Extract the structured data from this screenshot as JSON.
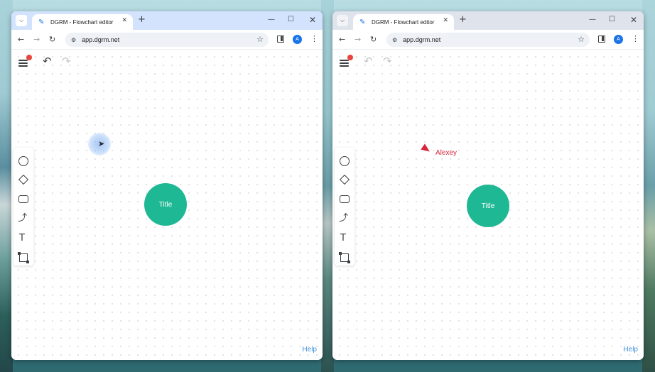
{
  "colors": {
    "node_fill": "#1fb894",
    "accent": "#1a73e8",
    "notification_dot": "#e8453c",
    "remote_cursor": "#d9263c",
    "help_link": "#3f8ed8"
  },
  "windows": [
    {
      "tab_title": "DGRM - Flowchart editor",
      "url": "app.dgrm.net",
      "avatar_letter": "A",
      "node_label": "Title",
      "help_label": "Help"
    },
    {
      "tab_title": "DGRM - Flowchart editor",
      "url": "app.dgrm.net",
      "avatar_letter": "A",
      "node_label": "Title",
      "help_label": "Help",
      "remote_user": "Alexey"
    }
  ],
  "icons": {
    "tab_search": "chevron-down-icon",
    "favicon": "pencil-icon",
    "new_tab": "plus-icon",
    "minimize": "minimize-icon",
    "maximize": "maximize-icon",
    "close": "close-icon",
    "back": "arrow-left-icon",
    "forward": "arrow-right-icon",
    "reload": "reload-icon",
    "site_info": "tune-icon",
    "bookmark": "star-icon",
    "side_panel": "side-panel-icon",
    "more": "kebab-icon",
    "menu": "hamburger-icon",
    "undo": "undo-icon",
    "redo": "redo-icon",
    "tools": [
      "circle-icon",
      "rhombus-icon",
      "rectangle-icon",
      "connector-icon",
      "text-icon",
      "frame-icon"
    ]
  }
}
